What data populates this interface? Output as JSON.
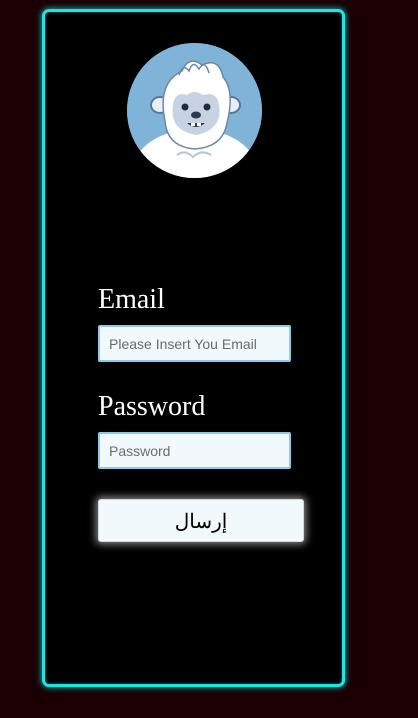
{
  "login_form": {
    "avatar": {
      "icon": "yeti-avatar-icon",
      "background_color": "#7fb3d8"
    },
    "email_label": "Email",
    "email_placeholder": "Please Insert You Email",
    "email_value": "",
    "password_label": "Password",
    "password_placeholder": "Password",
    "password_value": "",
    "submit_label": "إرسال"
  },
  "colors": {
    "page_background": "#1a0003",
    "card_background": "#000000",
    "card_border": "#19e6e6",
    "input_background": "#f1f9fc",
    "input_border": "#8ec9ea"
  }
}
